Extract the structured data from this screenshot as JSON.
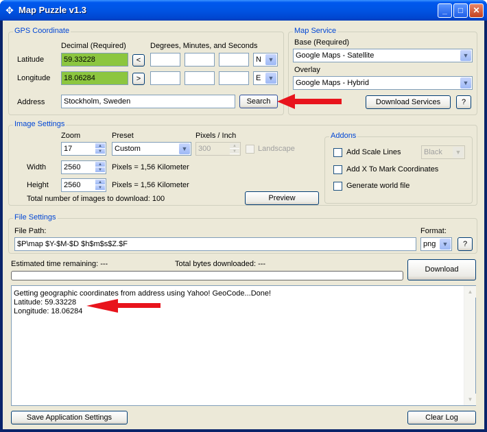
{
  "window": {
    "title": "Map Puzzle v1.3"
  },
  "gps": {
    "group_label": "GPS Coordinate",
    "decimal_header": "Decimal (Required)",
    "dms_header": "Degrees, Minutes, and Seconds",
    "latitude_label": "Latitude",
    "latitude_value": "59.33228",
    "longitude_label": "Longitude",
    "longitude_value": "18.06284",
    "lat_convert": "<",
    "lon_convert": ">",
    "lat_dir": "N",
    "lon_dir": "E",
    "address_label": "Address",
    "address_value": "Stockholm, Sweden",
    "search_label": "Search"
  },
  "map_service": {
    "group_label": "Map Service",
    "base_label": "Base (Required)",
    "base_value": "Google Maps - Satellite",
    "overlay_label": "Overlay",
    "overlay_value": "Google Maps - Hybrid",
    "download_services_label": "Download Services",
    "help_label": "?"
  },
  "image": {
    "group_label": "Image Settings",
    "zoom_label": "Zoom",
    "zoom_value": "17",
    "preset_label": "Preset",
    "preset_value": "Custom",
    "ppi_label": "Pixels / Inch",
    "ppi_value": "300",
    "landscape_label": "Landscape",
    "width_label": "Width",
    "width_value": "2560",
    "width_km": "Pixels = 1,56 Kilometer",
    "height_label": "Height",
    "height_value": "2560",
    "height_km": "Pixels = 1,56 Kilometer",
    "total_images": "Total number of images to download: 100",
    "preview_label": "Preview"
  },
  "addons": {
    "group_label": "Addons",
    "scale_lines": "Add Scale Lines",
    "scale_color": "Black",
    "mark_x": "Add X To Mark Coordinates",
    "world_file": "Generate world file"
  },
  "file": {
    "group_label": "File Settings",
    "path_label": "File Path:",
    "path_value": "$P\\map $Y-$M-$D $h$m$s$Z.$F",
    "format_label": "Format:",
    "format_value": "png",
    "help_label": "?"
  },
  "status": {
    "time_label": "Estimated time remaining: ---",
    "bytes_label": "Total bytes downloaded: ---",
    "download_label": "Download"
  },
  "log": [
    "Getting geographic coordinates from address using Yahoo! GeoCode...Done!",
    "Latitude: 59.33228",
    "Longitude: 18.06284"
  ],
  "footer": {
    "save_label": "Save Application Settings",
    "clear_label": "Clear Log"
  },
  "colors": {
    "annotation_arrow": "#e8141c",
    "field_highlight": "#8cc63f"
  }
}
